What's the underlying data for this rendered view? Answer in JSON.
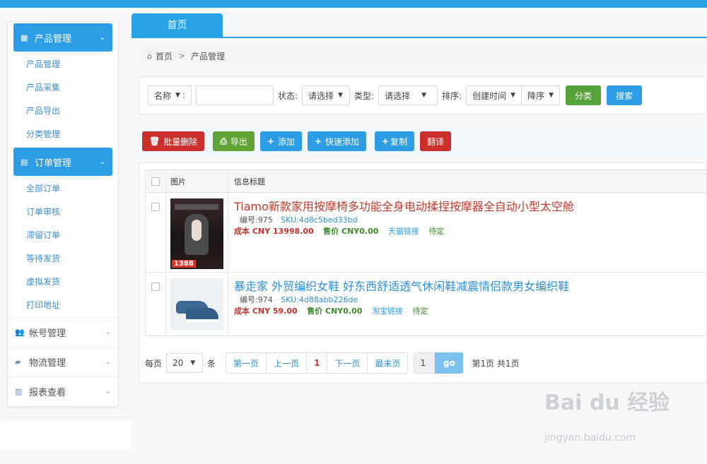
{
  "tab": {
    "label": "首页"
  },
  "breadcrumb": {
    "home": "首页",
    "sep": ">",
    "current": "产品管理"
  },
  "sidebar": {
    "groups": [
      {
        "label": "产品管理",
        "icon": "grid-icon",
        "expanded": true,
        "items": [
          "产品管理",
          "产品采集",
          "产品导出",
          "分类管理"
        ]
      },
      {
        "label": "订单管理",
        "icon": "list-icon",
        "expanded": true,
        "items": [
          "全部订单",
          "订单审核",
          "滞留订单",
          "等待发货",
          "虚拟发货",
          "打印地址"
        ]
      },
      {
        "label": "帐号管理",
        "icon": "users-icon",
        "expanded": false,
        "items": []
      },
      {
        "label": "物流管理",
        "icon": "truck-icon",
        "expanded": false,
        "items": []
      },
      {
        "label": "报表查看",
        "icon": "report-icon",
        "expanded": false,
        "items": []
      }
    ]
  },
  "filter": {
    "name_select": "名称",
    "name_colon": ":",
    "status_label": "状态:",
    "status_value": "请选择",
    "type_label": "类型:",
    "type_value": "请选择",
    "sort_label": "排序:",
    "sort_field": "创建时间",
    "sort_order": "降序",
    "category_btn": "分类",
    "search_btn": "搜索"
  },
  "toolbar": {
    "bulk_delete": "批量删除",
    "export": "导出",
    "add": "添加",
    "quick_add": "快速添加",
    "copy": "复制",
    "translate": "翻译"
  },
  "table": {
    "headers": {
      "image": "图片",
      "title": "信息标题"
    },
    "rows": [
      {
        "title": "Tiamo新款家用按摩椅多功能全身电动揉捏按摩器全自动小型太空舱",
        "number": "编号:975",
        "sku": "SKU:4d8c5bed33bd",
        "cost": "成本 CNY 13998.00",
        "sell": "售价 CNY0.00",
        "link": "天猫链接",
        "status": "待定",
        "thumb_tag": "1388"
      },
      {
        "title": "暴走家 外贸编织女鞋 好东西舒适透气休闲鞋减震情侣款男女编织鞋",
        "number": "编号:974",
        "sku": "SKU:4d88abb226de",
        "cost": "成本 CNY 59.00",
        "sell": "售价 CNY0.00",
        "link": "淘宝链接",
        "status": "待定"
      }
    ]
  },
  "pager": {
    "per_page_label": "每页",
    "per_page_value": "20",
    "unit": "条",
    "first": "第一页",
    "prev": "上一页",
    "current": "1",
    "next": "下一页",
    "last": "最末页",
    "goto_value": "1",
    "go": "go",
    "info": "第1页 共1页"
  },
  "watermark": {
    "main": "Bai du 经验",
    "sub": "jingyan.baidu.com"
  },
  "colors": {
    "accent": "#29a3e6",
    "danger": "#c9302c",
    "success": "#5fa434"
  }
}
